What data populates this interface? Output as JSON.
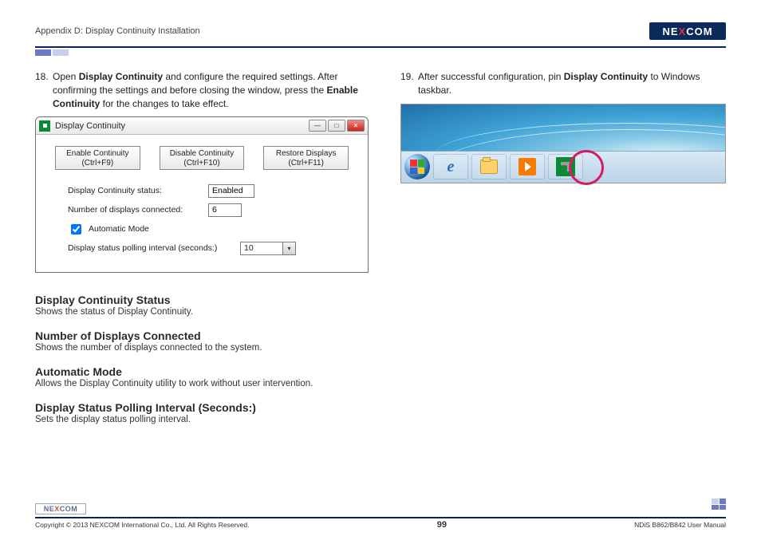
{
  "header": {
    "appendix": "Appendix D: Display Continuity Installation",
    "brand_pre": "NE",
    "brand_x": "X",
    "brand_post": "COM"
  },
  "left": {
    "step_num": "18.",
    "step_open": "Open ",
    "step_bold1": "Display Continuity",
    "step_mid": " and configure the required settings. After confirming the settings and before closing the window, press the ",
    "step_bold2": "Enable Continuity",
    "step_end": " for the changes to take effect."
  },
  "window": {
    "title": "Display Continuity",
    "btn1_line1": "Enable Continuity",
    "btn1_line2": "(Ctrl+F9)",
    "btn2_line1": "Disable Continuity",
    "btn2_line2": "(Ctrl+F10)",
    "btn3_line1": "Restore Displays",
    "btn3_line2": "(Ctrl+F11)",
    "label_status": "Display Continuity status:",
    "value_status": "Enabled",
    "label_count": "Number of displays connected:",
    "value_count": "6",
    "checkbox": "Automatic Mode",
    "label_interval": "Display status polling interval (seconds:)",
    "value_interval": "10",
    "min": "—",
    "max": "□",
    "close": "✕"
  },
  "desc": {
    "h1": "Display Continuity Status",
    "p1": "Shows the status of Display Continuity.",
    "h2": "Number of Displays Connected",
    "p2": "Shows the number of displays connected to the system.",
    "h3": "Automatic Mode",
    "p3": "Allows the Display Continuity utility to work without user intervention.",
    "h4": "Display Status Polling Interval (Seconds:)",
    "p4": "Sets the display status polling interval."
  },
  "right": {
    "step_num": "19.",
    "step_pre": "After successful configuration, pin ",
    "step_bold": "Display Continuity",
    "step_post": " to Windows taskbar."
  },
  "footer": {
    "brand_pre": "NE",
    "brand_x": "X",
    "brand_post": "COM",
    "copyright": "Copyright © 2013 NEXCOM International Co., Ltd. All Rights Reserved.",
    "pagenum": "99",
    "manual": "NDiS B862/B842 User Manual"
  }
}
